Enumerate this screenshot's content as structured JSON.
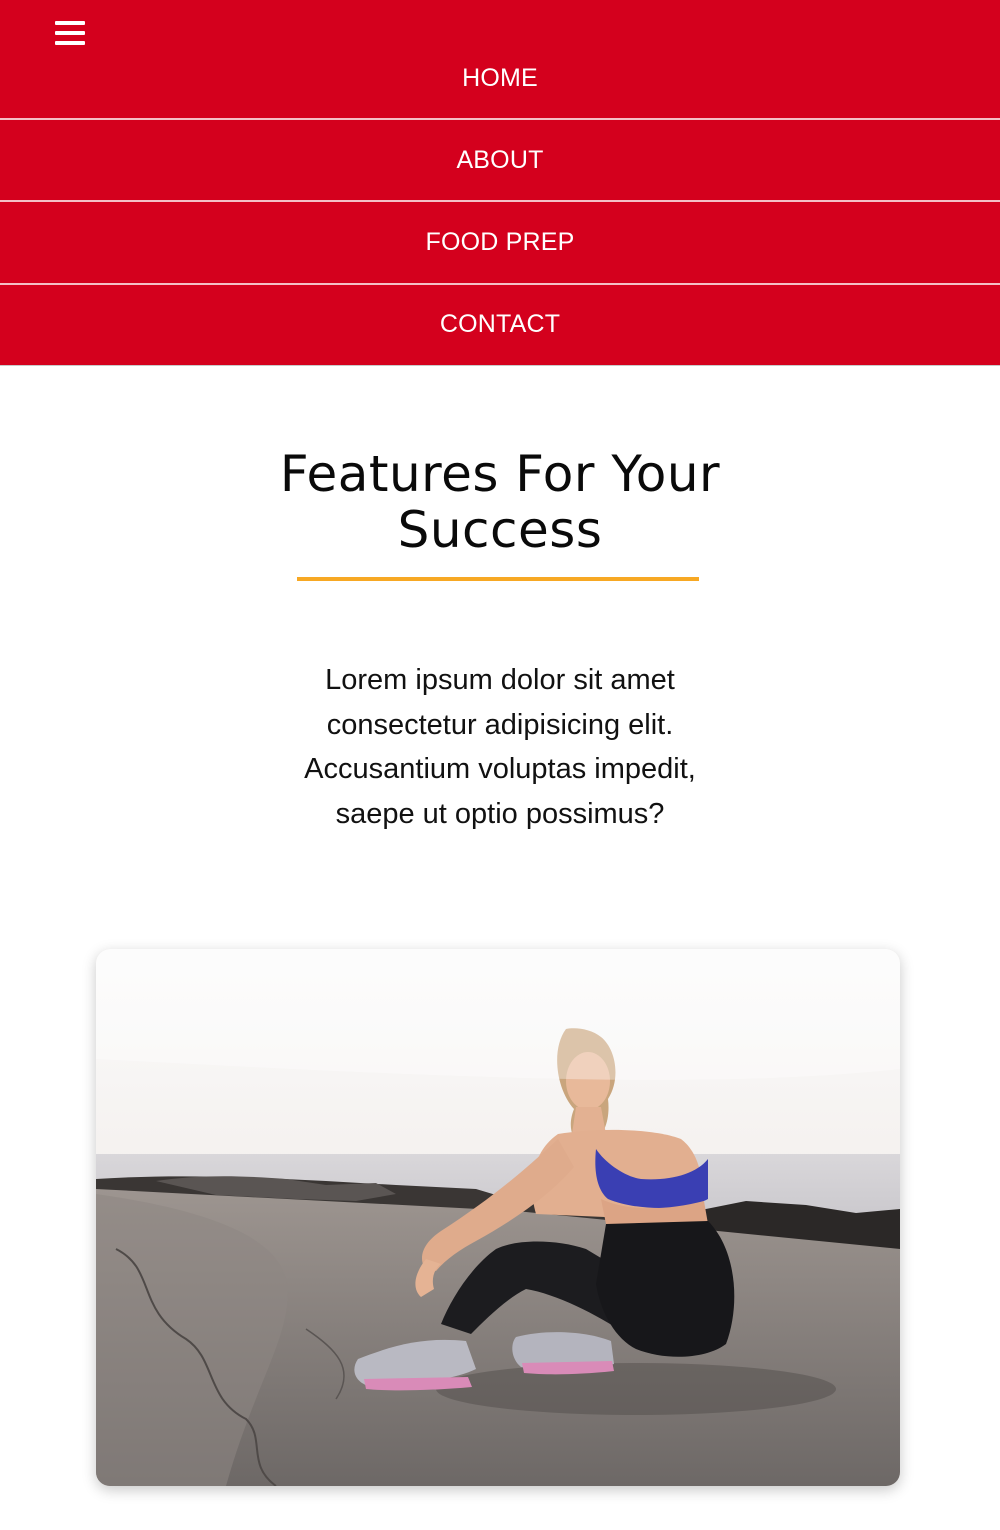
{
  "nav": {
    "menu_icon": "hamburger-menu-icon",
    "items": [
      {
        "label": "HOME"
      },
      {
        "label": "ABOUT"
      },
      {
        "label": "FOOD PREP"
      },
      {
        "label": "CONTACT"
      }
    ]
  },
  "features": {
    "title": "Features For Your Success",
    "description": "Lorem ipsum dolor sit amet consectetur adipisicing elit. Accusantium voluptas impedit, saepe ut optio possimus?"
  },
  "colors": {
    "nav_bg": "#d4001d",
    "accent_underline": "#f7a823"
  }
}
